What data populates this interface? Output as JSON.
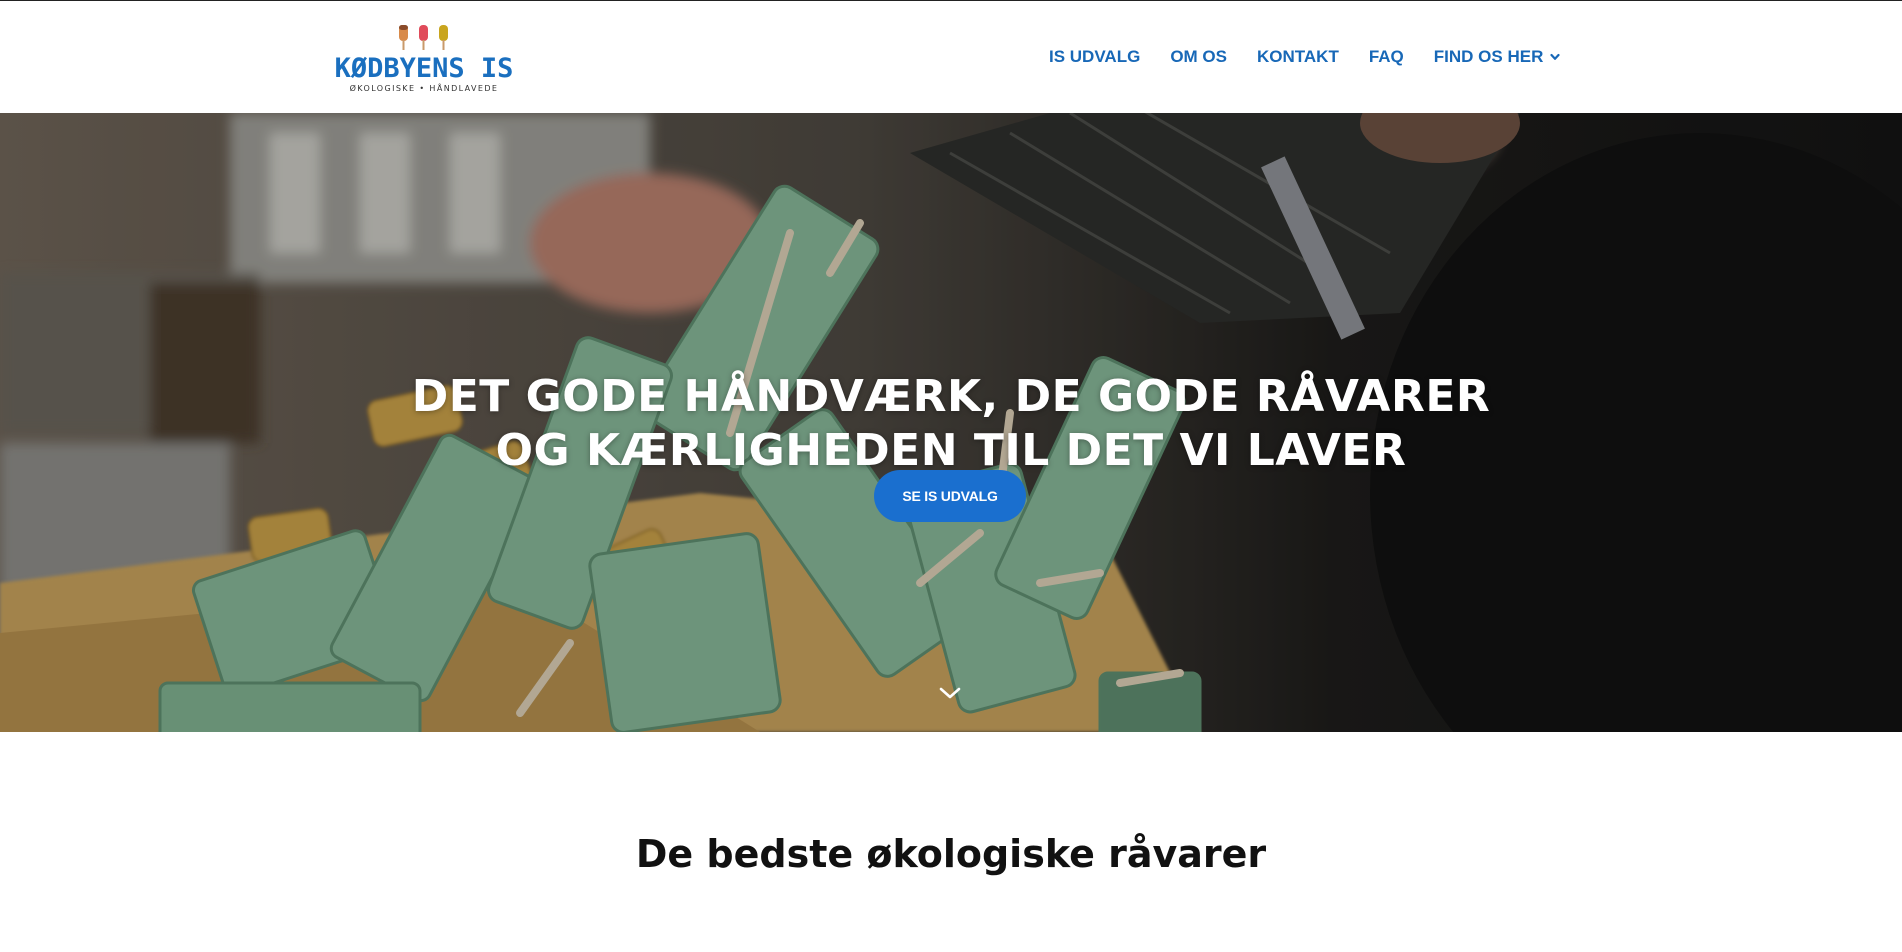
{
  "header": {
    "logo": {
      "name": "KØDBYENS IS",
      "tagline": "ØKOLOGISKE • HÅNDLAVEDE"
    },
    "nav": [
      {
        "label": "IS UDVALG"
      },
      {
        "label": "OM OS"
      },
      {
        "label": "KONTAKT"
      },
      {
        "label": "FAQ"
      },
      {
        "label": "FIND OS HER",
        "has_dropdown": true,
        "icon": "chevron-down-icon"
      }
    ]
  },
  "hero": {
    "title_line1": "DET GODE HÅNDVÆRK, DE GODE RÅVARER",
    "title_line2": "OG KÆRLIGHEDEN TIL DET VI LAVER",
    "button_label": "SE IS UDVALG",
    "scroll_icon": "chevron-down-icon",
    "image": "popsicles-being-unmolded"
  },
  "section": {
    "title": "De bedste økologiske råvarer"
  },
  "colors": {
    "brand_blue": "#1868b7",
    "button_blue": "#1a6fcf",
    "pop_orange": "#d88a4a",
    "pop_red": "#e04b5a",
    "pop_yellow": "#c9a51e"
  }
}
